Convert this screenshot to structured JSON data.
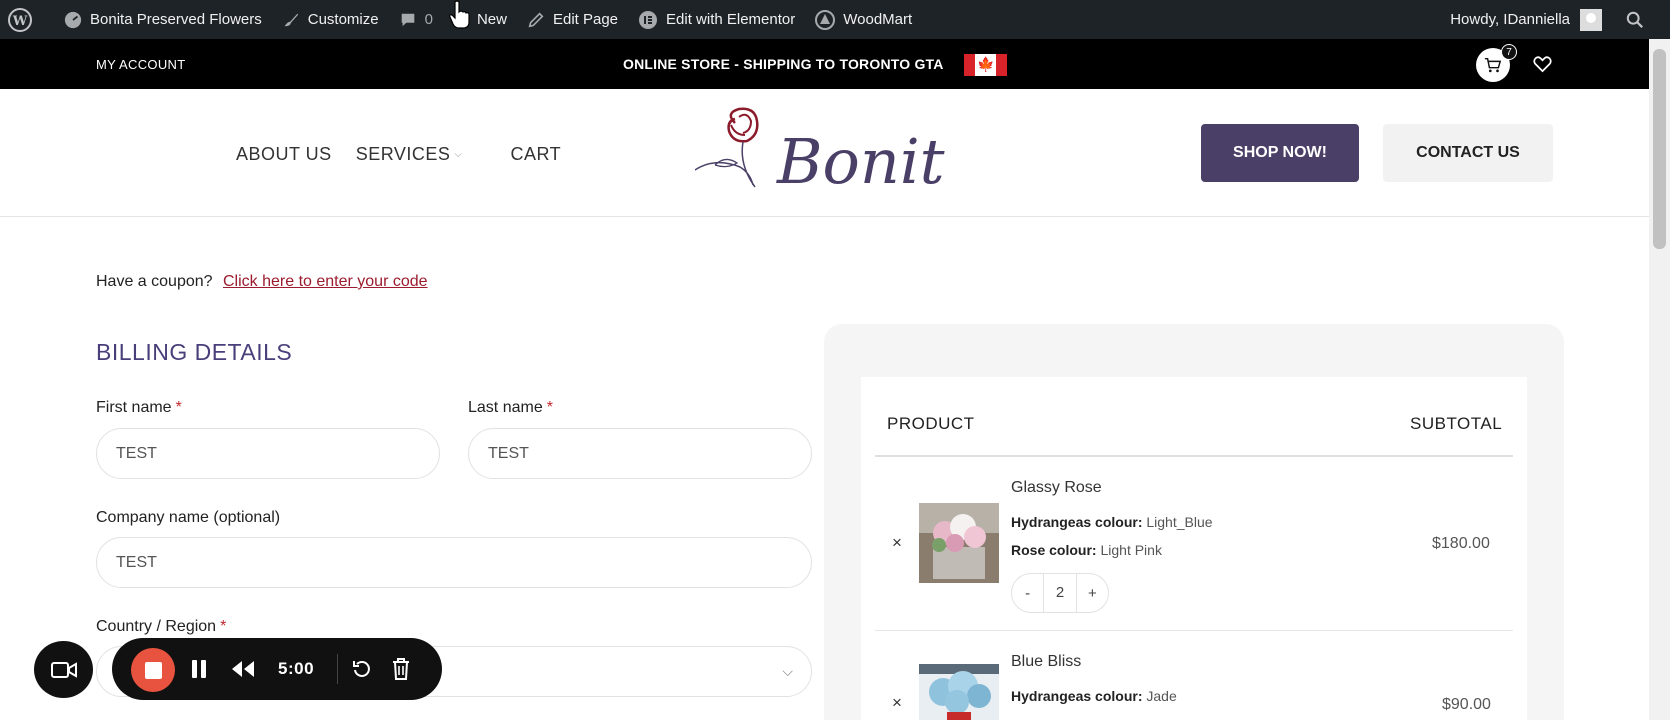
{
  "admin_bar": {
    "site_name": "Bonita Preserved Flowers",
    "customize": "Customize",
    "comments_count": "0",
    "new": "New",
    "edit_page": "Edit Page",
    "edit_elementor": "Edit with Elementor",
    "woodmart": "WoodMart",
    "howdy": "Howdy, IDanniella"
  },
  "topbar": {
    "my_account": "MY ACCOUNT",
    "shipping": "ONLINE STORE - SHIPPING TO TORONTO GTA",
    "cart_count": "7"
  },
  "header": {
    "nav": [
      "ABOUT US",
      "SERVICES",
      "CART"
    ],
    "logo_text": "Bonita",
    "shop_now": "SHOP NOW!",
    "contact_us": "CONTACT US"
  },
  "coupon": {
    "prompt": "Have a coupon?",
    "link": "Click here to enter your code"
  },
  "billing": {
    "title": "BILLING DETAILS",
    "first_name_label": "First name",
    "first_name_value": "TEST",
    "last_name_label": "Last name",
    "last_name_value": "TEST",
    "company_label": "Company name (optional)",
    "company_value": "TEST",
    "country_label": "Country / Region",
    "required_mark": "*"
  },
  "order": {
    "col_product": "PRODUCT",
    "col_subtotal": "SUBTOTAL",
    "remove": "×",
    "items": [
      {
        "name": "Glassy Rose",
        "meta1_key": "Hydrangeas colour:",
        "meta1_val": "Light_Blue",
        "meta2_key": "Rose colour:",
        "meta2_val": "Light Pink",
        "qty": "2",
        "price": "$180.00"
      },
      {
        "name": "Blue Bliss",
        "meta1_key": "Hydrangeas colour:",
        "meta1_val": "Jade",
        "price": "$90.00"
      }
    ],
    "qty_minus": "-",
    "qty_plus": "+"
  },
  "recorder": {
    "time": "5:00"
  },
  "colors": {
    "admin_bar": "#1d2327",
    "brand_purple": "#4a3f66",
    "link_red": "#9b1c2e",
    "record_red": "#e8533f"
  }
}
